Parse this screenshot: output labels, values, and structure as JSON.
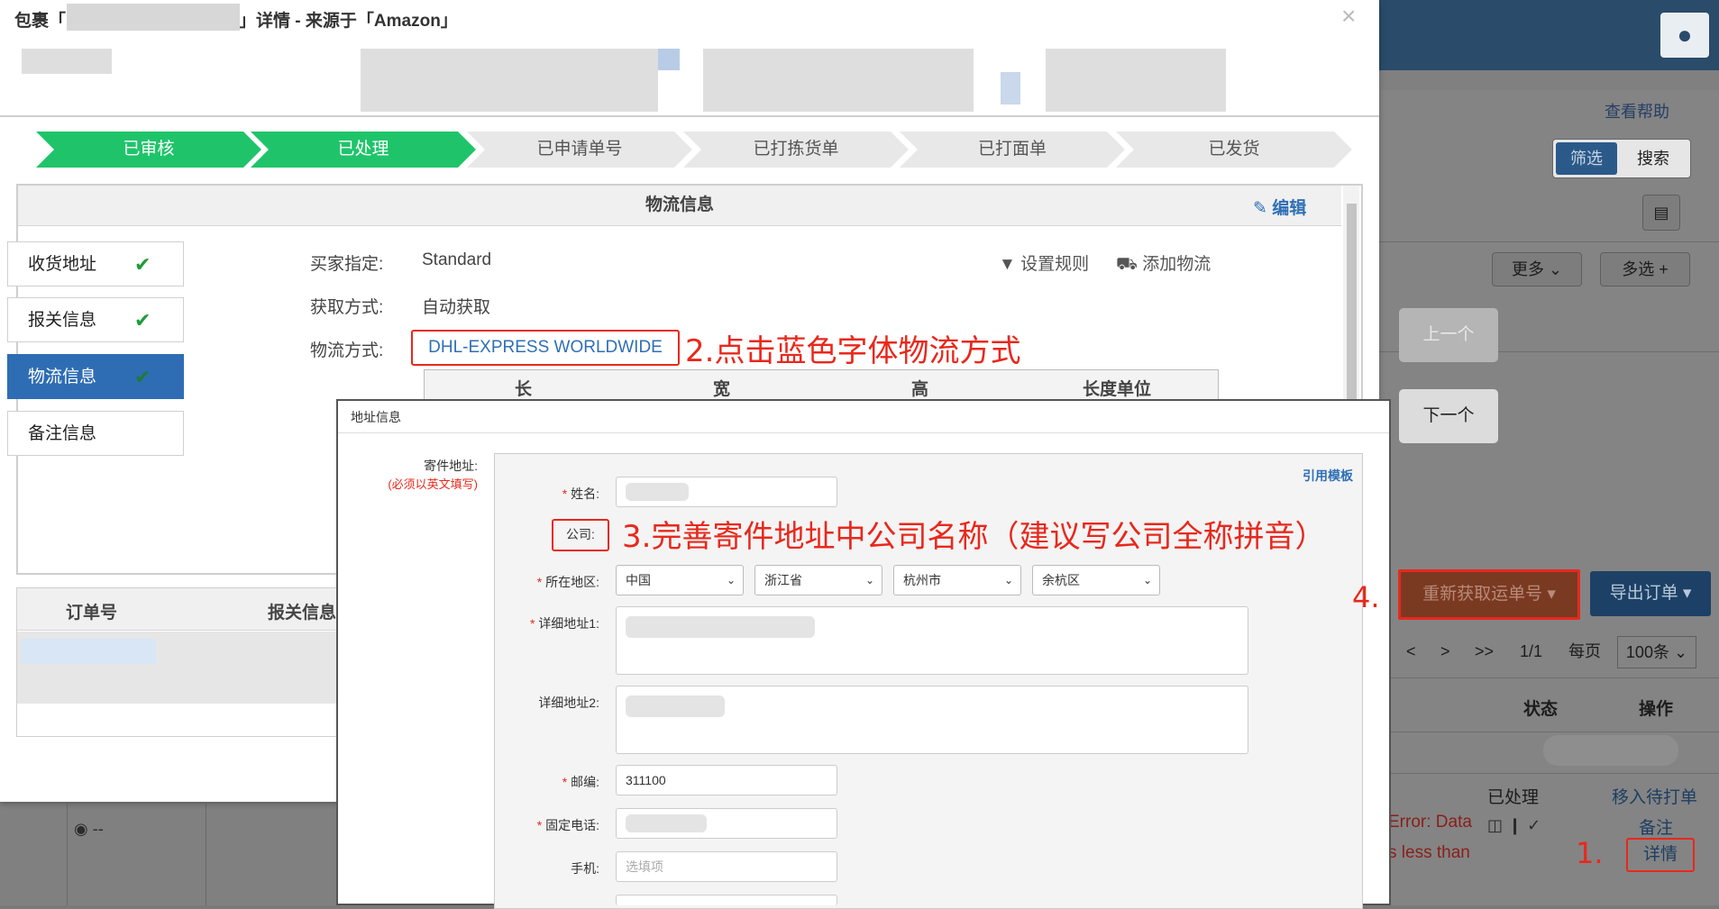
{
  "bg": {
    "help": "查看帮助",
    "filter_tab": "筛选",
    "search_tab": "搜索",
    "more": "更多",
    "multi": "多选 +",
    "prev": "上一个",
    "next": "下一个",
    "redo": "重新获取运单号",
    "export": "导出订单",
    "pager": {
      "prev": "<",
      "next": ">",
      "last": ">>",
      "page": "1/1",
      "per_label": "每页",
      "per_value": "100条"
    },
    "col_status": "状态",
    "col_action": "操作",
    "row_status": "已处理",
    "row_move": "移入待打单",
    "row_note": "备注",
    "row_detail": "详情",
    "error_line1": "Error: Data",
    "error_line2": "s less than",
    "cell_dash": "--"
  },
  "modal": {
    "title_prefix": "包裹「",
    "title_suffix": "」详情 - 来源于「Amazon」",
    "close": "×",
    "steps": [
      {
        "label": "已审核",
        "state": "done"
      },
      {
        "label": "已处理",
        "state": "done"
      },
      {
        "label": "已申请单号",
        "state": "todo"
      },
      {
        "label": "已打拣货单",
        "state": "todo"
      },
      {
        "label": "已打面单",
        "state": "todo"
      },
      {
        "label": "已发货",
        "state": "todo"
      }
    ],
    "panel_title": "物流信息",
    "edit": "编辑",
    "side": [
      {
        "label": "收货地址",
        "active": false
      },
      {
        "label": "报关信息",
        "active": false
      },
      {
        "label": "物流信息",
        "active": true
      },
      {
        "label": "备注信息",
        "active": false
      }
    ],
    "buyer_label": "买家指定:",
    "buyer_value": "Standard",
    "fetch_label": "获取方式:",
    "fetch_value": "自动获取",
    "method_label": "物流方式:",
    "method_value": "DHL-EXPRESS WORLDWIDE",
    "set_rule": "设置规则",
    "add_logistics": "添加物流",
    "dims": [
      "长",
      "宽",
      "高",
      "长度单位"
    ],
    "order_no": "订单号",
    "customs": "报关信息"
  },
  "address": {
    "title": "地址信息",
    "sender_label": "寄件地址:",
    "sender_note": "(必须以英文填写)",
    "template": "引用模板",
    "name_label": "姓名:",
    "company_label": "公司:",
    "region_label": "所在地区:",
    "country": "中国",
    "province": "浙江省",
    "city": "杭州市",
    "district": "余杭区",
    "addr1_label": "详细地址1:",
    "addr2_label": "详细地址2:",
    "zip_label": "邮编:",
    "zip_value": "311100",
    "phone_label": "固定电话:",
    "mobile_label": "手机:",
    "mobile_placeholder": "选填项"
  },
  "annotations": {
    "a1": "1.",
    "a2": "2.点击蓝色字体物流方式",
    "a3": "3.完善寄件地址中公司名称（建议写公司全称拼音）",
    "a4": "4."
  },
  "colors": {
    "step_done": "#1fc46a",
    "active_side": "#2e6db4",
    "annotation": "#e8281c",
    "link": "#2f6fb5"
  }
}
